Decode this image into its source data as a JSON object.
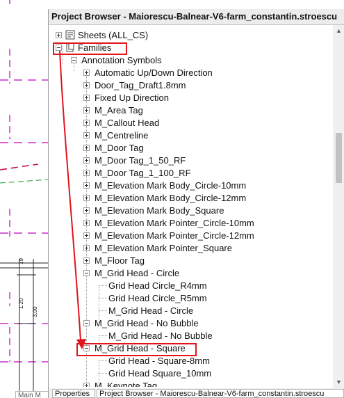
{
  "panel": {
    "title": "Project Browser - Maiorescu-Balnear-V6-farm_constantin.stroescu"
  },
  "drawing": {
    "dim_labels": [
      "19",
      "1.20",
      "3.00"
    ],
    "view_tab_label": "Main M"
  },
  "tree": {
    "sheets_label": "Sheets (ALL_CS)",
    "families_label": "Families",
    "annotation_symbols_label": "Annotation Symbols",
    "items": [
      "Automatic Up/Down Direction",
      "Door_Tag_Draft1.8mm",
      "Fixed Up Direction",
      "M_Area Tag",
      "M_Callout Head",
      "M_Centreline",
      "M_Door Tag",
      "M_Door Tag_1_50_RF",
      "M_Door Tag_1_100_RF",
      "M_Elevation Mark Body_Circle-10mm",
      "M_Elevation Mark Body_Circle-12mm",
      "M_Elevation Mark Body_Square",
      "M_Elevation Mark Pointer_Circle-10mm",
      "M_Elevation Mark Pointer_Circle-12mm",
      "M_Elevation Mark Pointer_Square",
      "M_Floor Tag"
    ],
    "grid_head_circle": {
      "label": "M_Grid Head - Circle",
      "children": [
        "Grid Head Circle_R4mm",
        "Grid Head Circle_R5mm",
        "M_Grid Head - Circle"
      ]
    },
    "grid_head_no_bubble": {
      "label": "M_Grid Head - No Bubble",
      "children": [
        "M_Grid Head - No Bubble"
      ]
    },
    "grid_head_square": {
      "label": "M_Grid Head - Square",
      "children": [
        "Grid Head - Square-8mm",
        "Grid Head Square_10mm"
      ]
    },
    "next_item_partial": "M_Keynote Tag"
  },
  "bottom_tabs": {
    "properties": "Properties",
    "project_browser": "Project Browser - Maiorescu-Balnear-V6-farm_constantin.stroescu"
  },
  "colors": {
    "highlight_border": "#e1141b",
    "arrow": "#e1141b",
    "drawing_magenta": "#c000c0"
  }
}
